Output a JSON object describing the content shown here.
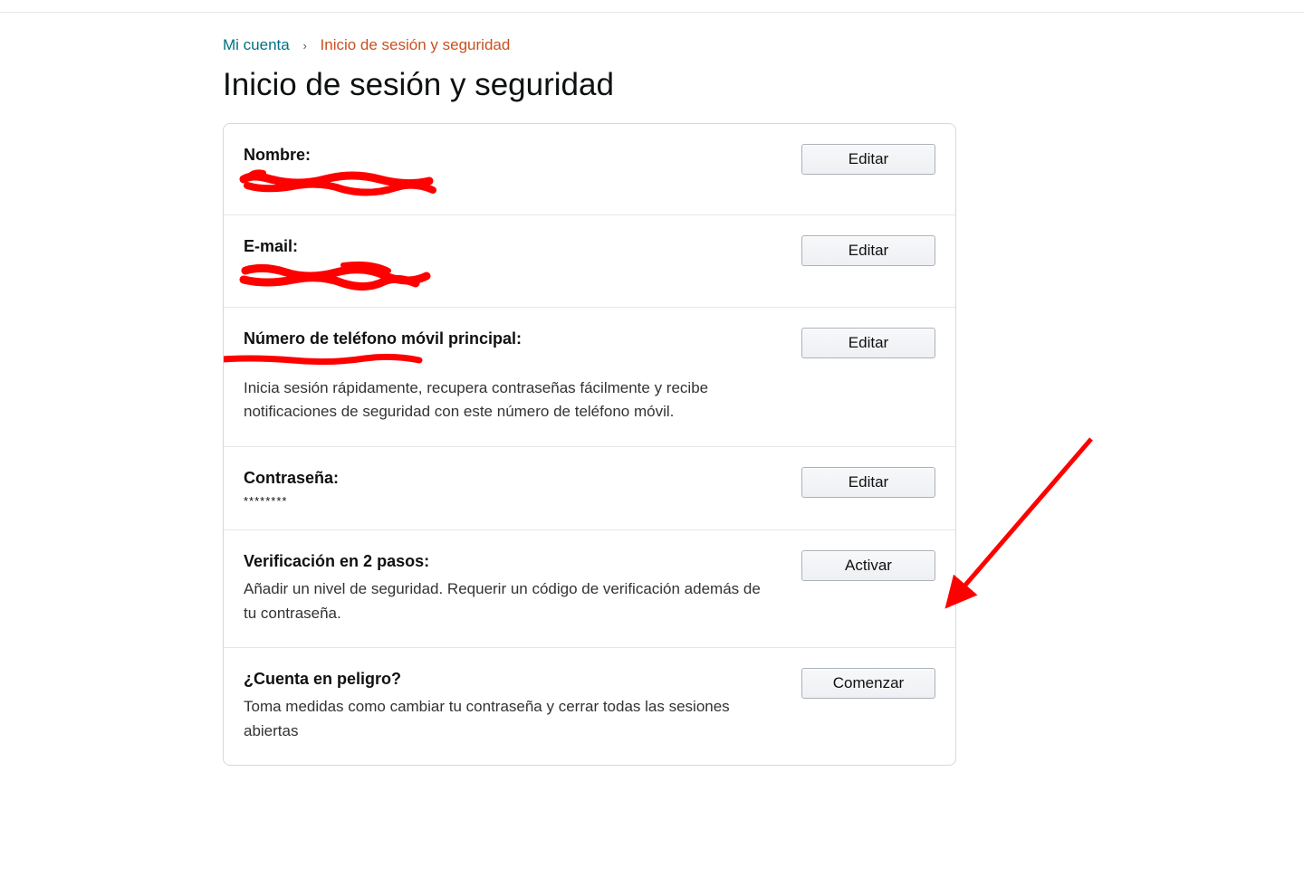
{
  "breadcrumb": {
    "account": "Mi cuenta",
    "current": "Inicio de sesión y seguridad"
  },
  "title": "Inicio de sesión y seguridad",
  "rows": {
    "name": {
      "label": "Nombre:",
      "button": "Editar"
    },
    "email": {
      "label": "E-mail:",
      "button": "Editar"
    },
    "phone": {
      "label": "Número de teléfono móvil principal:",
      "desc": "Inicia sesión rápidamente, recupera contraseñas fácilmente y recibe notificaciones de seguridad con este número de teléfono móvil.",
      "button": "Editar"
    },
    "password": {
      "label": "Contraseña:",
      "mask": "********",
      "button": "Editar"
    },
    "twostep": {
      "label": "Verificación en 2 pasos:",
      "desc": "Añadir un nivel de seguridad. Requerir un código de verificación además de tu contraseña.",
      "button": "Activar"
    },
    "danger": {
      "label": "¿Cuenta en peligro?",
      "desc": "Toma medidas como cambiar tu contraseña y cerrar todas las sesiones abiertas",
      "button": "Comenzar"
    }
  }
}
